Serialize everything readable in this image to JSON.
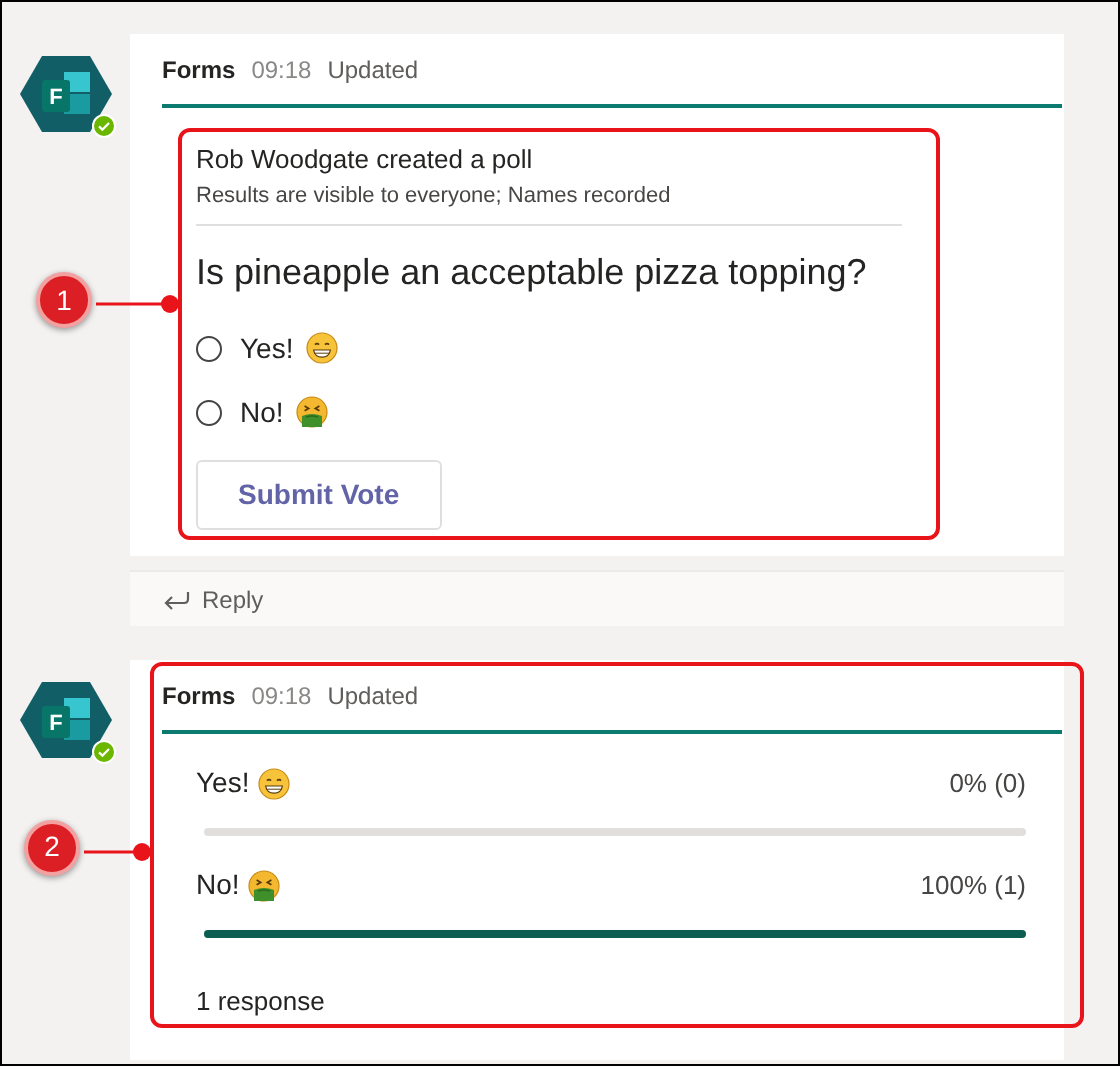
{
  "messages": [
    {
      "kind": "poll",
      "avatar": {
        "logo_letter": "F",
        "online": true
      },
      "sender": "Forms",
      "time": "09:18",
      "status": "Updated",
      "poll": {
        "creator_line": "Rob Woodgate created a poll",
        "visibility": "Results are visible to everyone; Names recorded",
        "question": "Is pineapple an acceptable pizza topping?",
        "options": [
          {
            "label": "Yes!",
            "kind": "grin",
            "selected": false
          },
          {
            "label": "No!",
            "kind": "sick",
            "selected": false
          }
        ],
        "submit_button": "Submit Vote"
      },
      "reply": "Reply"
    },
    {
      "kind": "results",
      "avatar": {
        "logo_letter": "F",
        "online": true
      },
      "sender": "Forms",
      "time": "09:18",
      "status": "Updated",
      "results": [
        {
          "label": "Yes!",
          "kind": "grin",
          "reading": "0% (0)",
          "level": 0
        },
        {
          "label": "No!",
          "kind": "sick",
          "reading": "100% (1)",
          "level": 1
        }
      ],
      "response_count": "1 response"
    }
  ],
  "annotations": [
    {
      "number": "1"
    },
    {
      "number": "2"
    }
  ]
}
